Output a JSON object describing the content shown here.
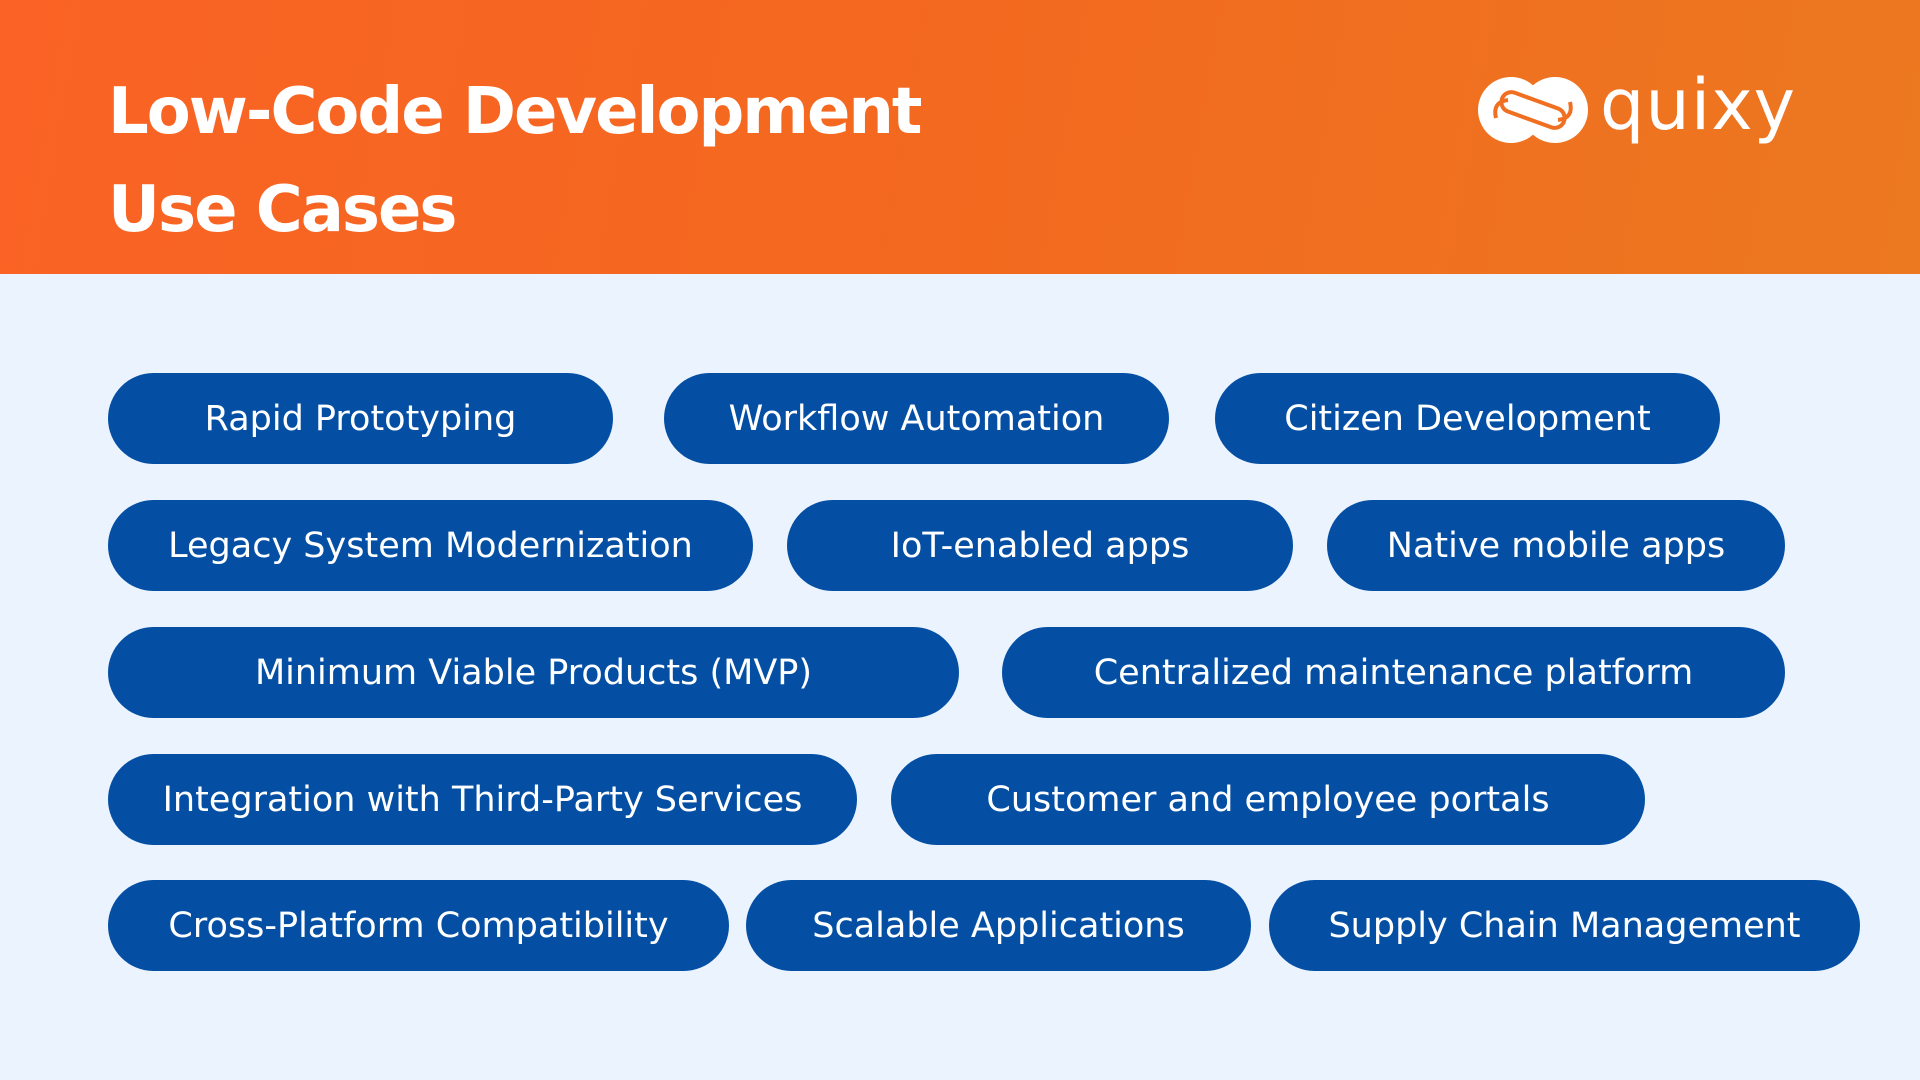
{
  "header": {
    "title_line1": "Low-Code Development",
    "title_line2": "Use Cases",
    "logo_text": "quixy",
    "logo_icon": "infinity-link-icon"
  },
  "colors": {
    "header_start": "#fa6325",
    "header_end": "#ec7820",
    "background": "#ebf3fe",
    "pill": "#044fa4",
    "text_on_color": "#ffffff"
  },
  "use_cases": [
    {
      "label": "Rapid Prototyping"
    },
    {
      "label": "Workflow Automation"
    },
    {
      "label": "Citizen Development"
    },
    {
      "label": "Legacy System Modernization"
    },
    {
      "label": "IoT-enabled apps"
    },
    {
      "label": "Native mobile apps"
    },
    {
      "label": "Minimum Viable Products (MVP)"
    },
    {
      "label": "Centralized maintenance platform"
    },
    {
      "label": "Integration with Third-Party Services"
    },
    {
      "label": "Customer and employee portals"
    },
    {
      "label": "Cross-Platform Compatibility"
    },
    {
      "label": "Scalable Applications"
    },
    {
      "label": "Supply Chain Management"
    }
  ]
}
